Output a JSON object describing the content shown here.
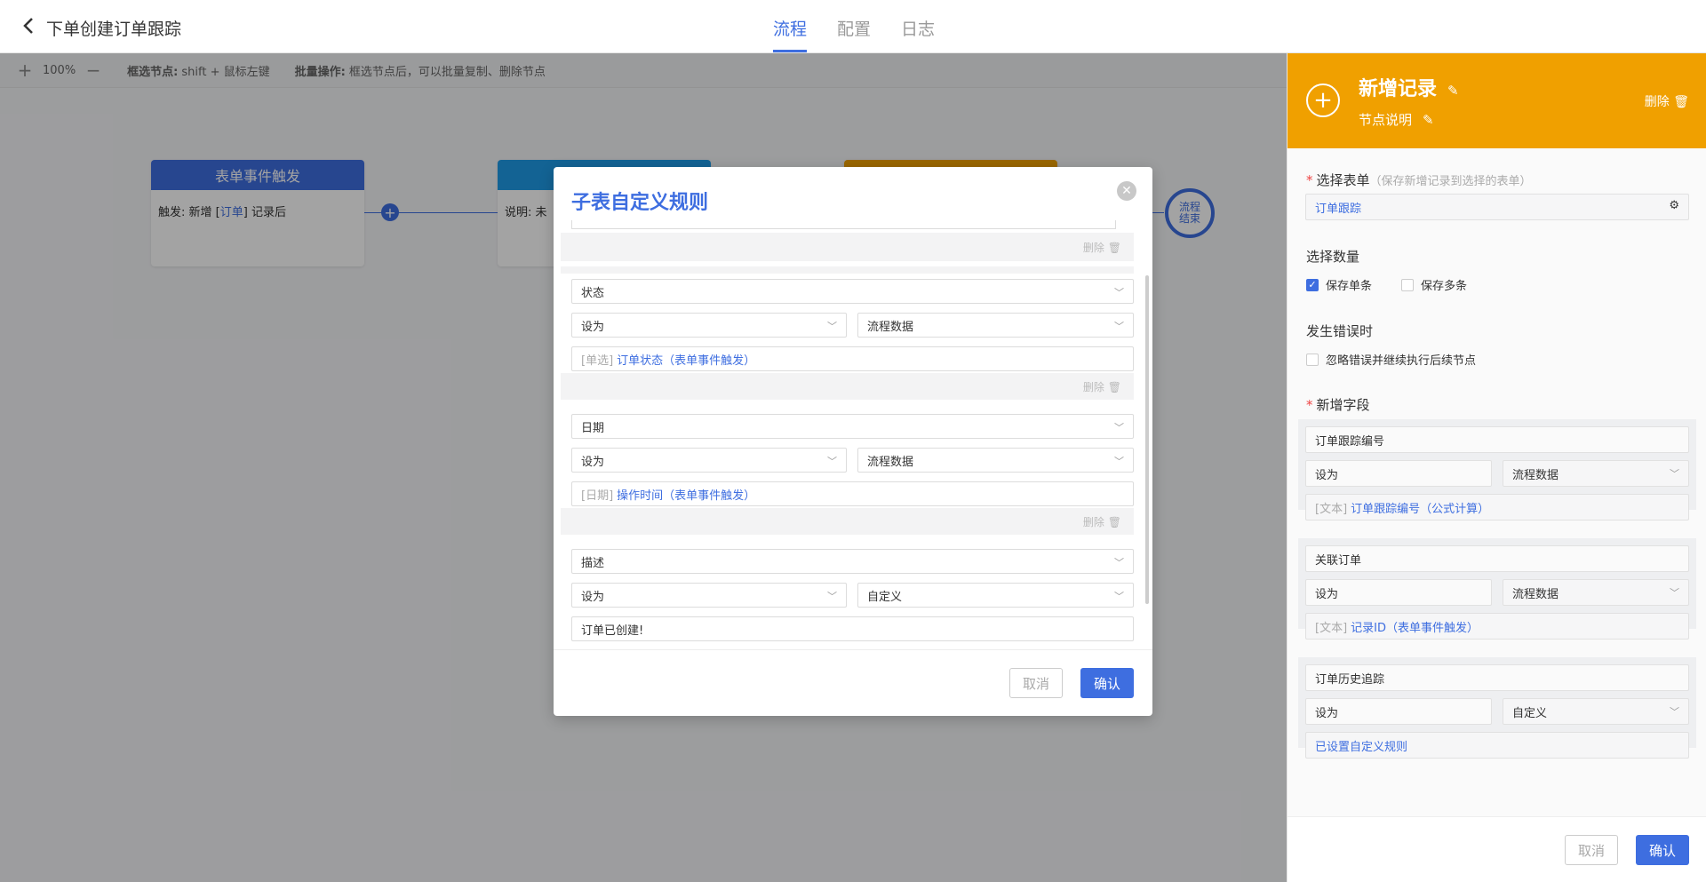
{
  "topbar": {
    "title": "下单创建订单跟踪",
    "tabs": [
      "流程",
      "配置",
      "日志"
    ]
  },
  "toolbar": {
    "zoom": "100%",
    "hint1_label": "框选节点:",
    "hint1_text": "shift + 鼠标左键",
    "hint2_label": "批量操作:",
    "hint2_text": "框选节点后，可以批量复制、删除节点"
  },
  "nodes": {
    "trigger": {
      "title": "表单事件触发",
      "prefix": "触发: 新增 [",
      "form": "订单",
      "suffix": "] 记录后"
    },
    "node2": {
      "desc": "说明: 未"
    },
    "end": "流程结束"
  },
  "modal": {
    "title": "子表自定义规则",
    "delete_label": "删除",
    "rules": [
      {
        "field": "状态",
        "op": "设为",
        "source": "流程数据",
        "tag": "[单选]",
        "value": "订单状态（表单事件触发）"
      },
      {
        "field": "日期",
        "op": "设为",
        "source": "流程数据",
        "tag": "[日期]",
        "value": "操作时间（表单事件触发）"
      },
      {
        "field": "描述",
        "op": "设为",
        "source": "自定义",
        "value": "订单已创建!"
      }
    ],
    "cancel": "取消",
    "confirm": "确认"
  },
  "panel": {
    "title": "新增记录",
    "subtitle": "节点说明",
    "delete": "删除",
    "select_form_label": "选择表单",
    "select_form_hint": "（保存新增记录到选择的表单）",
    "select_form_value": "订单跟踪",
    "count_label": "选择数量",
    "count_options": [
      "保存单条",
      "保存多条"
    ],
    "count_selected": "保存单条",
    "error_label": "发生错误时",
    "error_option": "忽略错误并继续执行后续节点",
    "fields_label": "新增字段",
    "fields": [
      {
        "name": "订单跟踪编号",
        "op": "设为",
        "source": "流程数据",
        "tag": "[文本]",
        "value": "订单跟踪编号（公式计算）"
      },
      {
        "name": "关联订单",
        "op": "设为",
        "source": "流程数据",
        "tag": "[文本]",
        "value": "记录ID（表单事件触发）"
      },
      {
        "name": "订单历史追踪",
        "op": "设为",
        "source": "自定义",
        "value": "已设置自定义规则"
      }
    ],
    "cancel": "取消",
    "confirm": "确认"
  },
  "colors": {
    "accent": "#3e6ee0",
    "panel_header": "#f0a000",
    "node_blue": "#3e6ee0"
  }
}
